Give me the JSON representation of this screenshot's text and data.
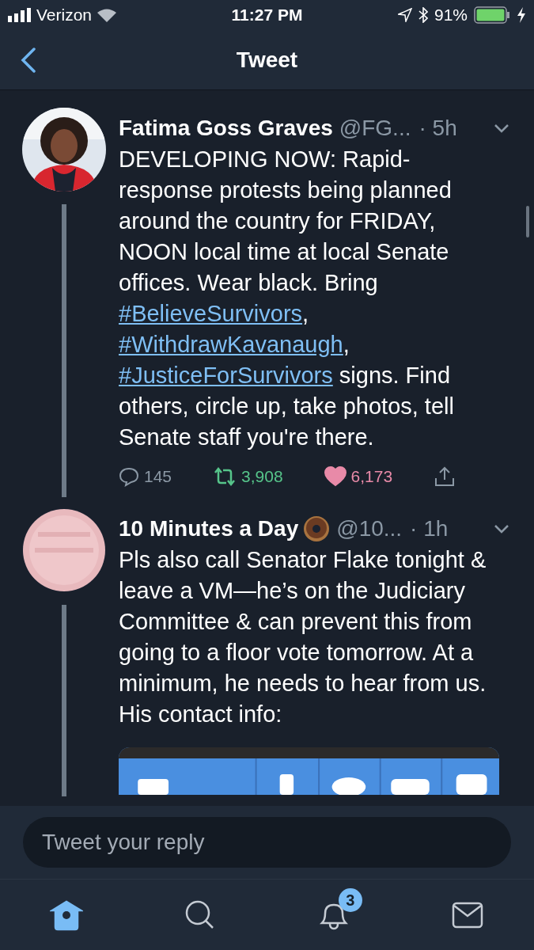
{
  "status_bar": {
    "carrier": "Verizon",
    "time": "11:27 PM",
    "battery": "91%"
  },
  "nav": {
    "title": "Tweet"
  },
  "tweets": [
    {
      "name": "Fatima Goss Graves",
      "emoji": false,
      "handle": "@FG...",
      "time": "· 5h",
      "body": [
        {
          "kind": "text",
          "text": "DEVELOPING NOW: Rapid-response protests being planned around the country for FRIDAY, NOON local time at local Senate offices. Wear black. Bring "
        },
        {
          "kind": "link",
          "text": "#BelieveSurvivors"
        },
        {
          "kind": "text",
          "text": ", "
        },
        {
          "kind": "link",
          "text": "#WithdrawKavanaugh"
        },
        {
          "kind": "text",
          "text": ", "
        },
        {
          "kind": "link",
          "text": "#JusticeForSurvivors"
        },
        {
          "kind": "text",
          "text": " signs. Find others, circle up, take photos, tell Senate staff you're there."
        }
      ],
      "avatar": {
        "kind": "picture"
      },
      "actions": {
        "replies": "145",
        "retweets": "3,908",
        "retweeted": true,
        "likes": "6,173",
        "liked": true
      },
      "media": false
    },
    {
      "name": "10 Minutes a Day",
      "emoji": true,
      "handle": "@10...",
      "time": "· 1h",
      "body": [
        {
          "kind": "text",
          "text": "Pls also call Senator Flake tonight & leave a VM—he’s on the Judiciary Committee & can prevent this from going to a floor vote tomorrow. At a minimum, he needs to hear from us. His contact info:"
        }
      ],
      "avatar": {
        "kind": "picture"
      },
      "media": true
    }
  ],
  "reply": {
    "placeholder": "Tweet your reply"
  },
  "tabs": [
    {
      "kind": "home",
      "selected": true
    },
    {
      "kind": "search",
      "selected": false
    },
    {
      "kind": "notifications",
      "selected": false,
      "badge": "3"
    },
    {
      "kind": "messages",
      "selected": false
    }
  ]
}
